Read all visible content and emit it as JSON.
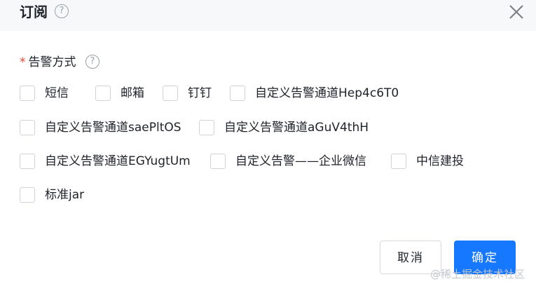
{
  "dialog": {
    "title": "订阅",
    "help_glyph": "?",
    "close_icon": "close-icon"
  },
  "form": {
    "required_mark": "*",
    "label": "告警方式",
    "help_glyph": "?",
    "options": [
      {
        "label": "短信",
        "checked": false
      },
      {
        "label": "邮箱",
        "checked": false
      },
      {
        "label": "钉钉",
        "checked": false
      },
      {
        "label": "自定义告警通道Hep4c6T0",
        "checked": false
      },
      {
        "label": "自定义告警通道saePltOS",
        "checked": false
      },
      {
        "label": "自定义告警通道aGuV4thH",
        "checked": false
      },
      {
        "label": "自定义告警通道EGYugtUm",
        "checked": false
      },
      {
        "label": "自定义告警——企业微信",
        "checked": false
      },
      {
        "label": "中信建投",
        "checked": false
      },
      {
        "label": "标准jar",
        "checked": false
      }
    ]
  },
  "footer": {
    "cancel_label": "取消",
    "ok_label": "确定"
  },
  "watermark": "@稀土掘金技术社区",
  "colors": {
    "primary": "#1677ff",
    "required": "#f5432c",
    "header_bg": "#f7f8fa"
  }
}
